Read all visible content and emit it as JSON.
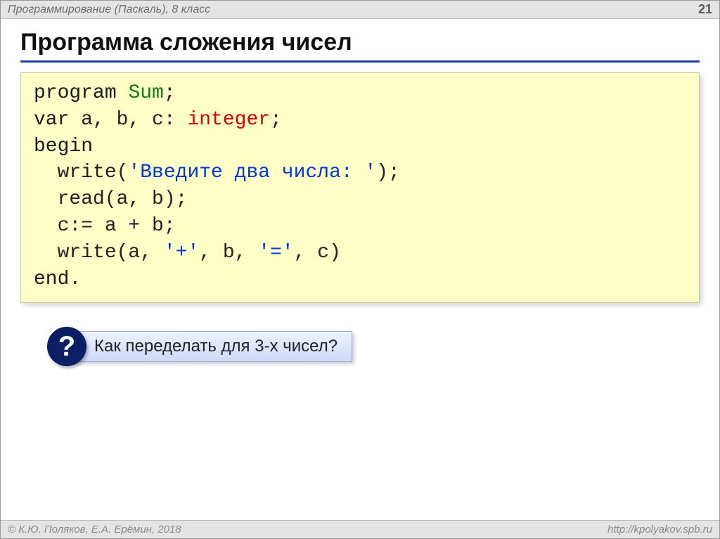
{
  "header": {
    "left": "Программирование (Паскаль), 8 класс",
    "page": "21"
  },
  "title": "Программа сложения чисел",
  "code": {
    "kw_program": "program",
    "progname": "Sum",
    "semicolon": ";",
    "kw_var": "var",
    "vars": " a, b, c: ",
    "type_int": "integer",
    "kw_begin": "begin",
    "indent": "  ",
    "write1a": "write(",
    "str1": "'Введите два числа: '",
    "write1b": ");",
    "read": "read(a, b);",
    "assign": "c:= a + b;",
    "write2a": "write(a, ",
    "str_plus": "'+'",
    "write2b": ", b, ",
    "str_eq": "'='",
    "write2c": ", c)",
    "kw_end": "end."
  },
  "question": {
    "mark": "?",
    "text": " Как переделать для 3-х чисел?"
  },
  "footer": {
    "left": "© К.Ю. Поляков, Е.А. Ерёмин, 2018",
    "right": "http://kpolyakov.spb.ru"
  }
}
